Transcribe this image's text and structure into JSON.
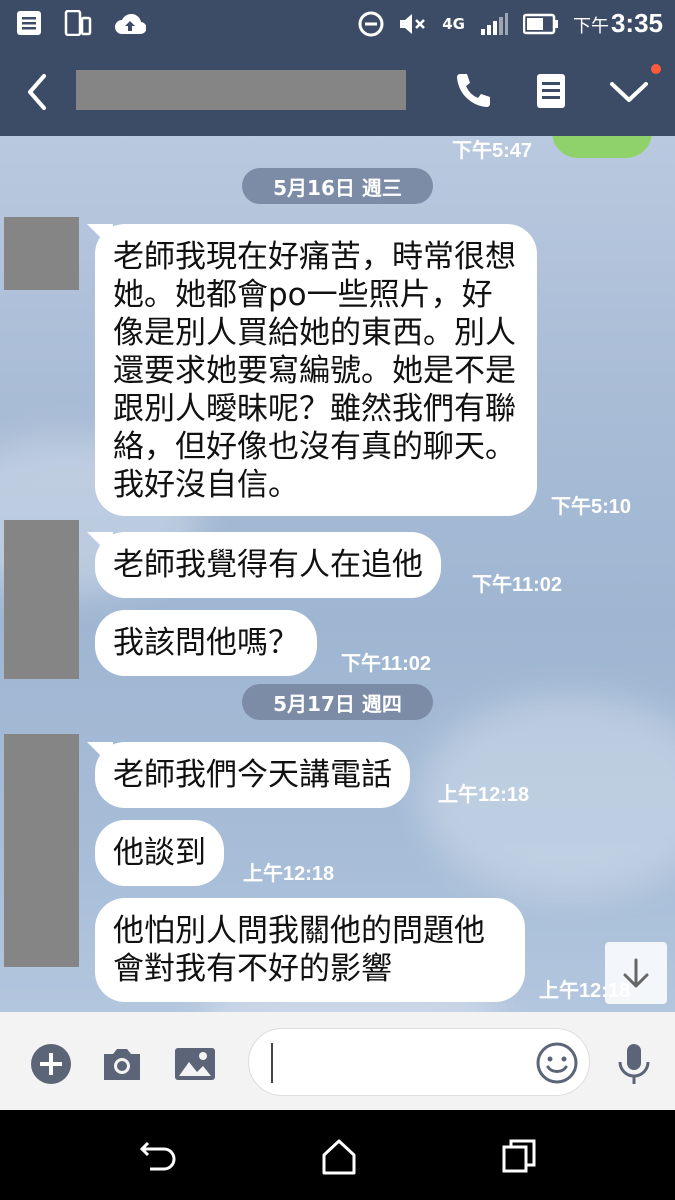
{
  "status_bar": {
    "time_prefix": "下午",
    "time": "3:35",
    "network_label": "4G"
  },
  "header": {
    "contact_name_redacted": true,
    "icons": [
      "back-icon",
      "phone-icon",
      "notes-icon",
      "chevron-down-icon"
    ]
  },
  "chat": {
    "previous_message_time": "下午5:47",
    "messages_groups": [
      {
        "date": "5月16日 週三",
        "messages": [
          {
            "text": "老師我現在好痛苦，時常很想她。她都會po一些照片，好像是別人買給她的東西。別人還要求她要寫編號。她是不是跟別人曖昧呢？雖然我們有聯絡，但好像也沒有真的聊天。我好沒自信。",
            "time": "下午5:10"
          },
          {
            "text": "老師我覺得有人在追他",
            "time": "下午11:02"
          },
          {
            "text": "我該問他嗎？",
            "time": "下午11:02"
          }
        ]
      },
      {
        "date": "5月17日 週四",
        "messages": [
          {
            "text": "老師我們今天講電話",
            "time": "上午12:18"
          },
          {
            "text": "他談到",
            "time": "上午12:18"
          },
          {
            "text": "他怕別人問我關他的問題他會對我有不好的影響",
            "time": "上午12:18"
          }
        ]
      }
    ]
  },
  "input_bar": {
    "icons": [
      "add-icon",
      "camera-icon",
      "image-icon",
      "emoji-icon",
      "microphone-icon"
    ],
    "value": ""
  },
  "colors": {
    "header_bg": "#3d4c66",
    "date_pill": "#7c8ba6",
    "bubble": "#ffffff",
    "sent_bubble": "#8fd26a"
  }
}
